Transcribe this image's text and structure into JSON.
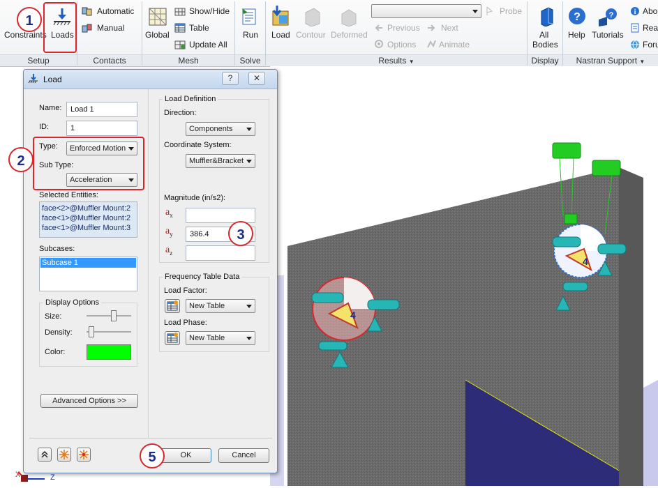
{
  "ribbon": {
    "setup": {
      "constraints": "Constraints",
      "loads": "Loads",
      "label": "Setup"
    },
    "contacts": {
      "automatic": "Automatic",
      "manual": "Manual",
      "label": "Contacts"
    },
    "mesh": {
      "global": "Global",
      "show_hide": "Show/Hide",
      "table": "Table",
      "update_all": "Update  All",
      "label": "Mesh"
    },
    "solve": {
      "run": "Run",
      "label": "Solve"
    },
    "results": {
      "load": "Load",
      "contour": "Contour",
      "deformed": "Deformed",
      "previous": "Previous",
      "next": "Next",
      "options": "Options",
      "animate": "Animate",
      "probe": "Probe",
      "label": "Results"
    },
    "display": {
      "all_bodies": "All Bodies",
      "all_bodies_l1": "All",
      "all_bodies_l2": "Bodies",
      "label": "Display"
    },
    "nastran": {
      "help": "Help",
      "tutorials": "Tutorials",
      "about": "Abo",
      "read": "Rea",
      "forum": "Foru",
      "label": "Nastran Support"
    }
  },
  "dialog": {
    "title": "Load",
    "help_btn": "?",
    "close_btn": "✕",
    "name_label": "Name:",
    "name_value": "Load 1",
    "id_label": "ID:",
    "id_value": "1",
    "type_label": "Type:",
    "type_value": "Enforced Motion",
    "subtype_label": "Sub Type:",
    "subtype_value": "Acceleration",
    "selected_label": "Selected Entities:",
    "entities": [
      "face<2>@Muffler Mount:2",
      "face<1>@Muffler Mount:2",
      "face<1>@Muffler Mount:3"
    ],
    "subcases_label": "Subcases:",
    "subcases": [
      "Subcase 1"
    ],
    "display_options": "Display Options",
    "size_label": "Size:",
    "density_label": "Density:",
    "color_label": "Color:",
    "color_value": "#00ff00",
    "size_level": 0.6,
    "density_level": 0.05,
    "advanced_btn": "Advanced Options >>",
    "load_definition": "Load Definition",
    "direction_label": "Direction:",
    "direction_value": "Components",
    "coord_label": "Coordinate System:",
    "coord_value": "Muffler&Bracket",
    "magnitude_label": "Magnitude (in/s2):",
    "ax_label": "a",
    "ax_sub": "x",
    "ax_value": "",
    "ay_label": "a",
    "ay_sub": "y",
    "ay_value": "386.4",
    "az_label": "a",
    "az_sub": "z",
    "az_value": "",
    "freq_label": "Frequency Table Data",
    "load_factor_label": "Load Factor:",
    "load_factor_value": "New Table",
    "load_phase_label": "Load Phase:",
    "load_phase_value": "New Table",
    "ok": "OK",
    "cancel": "Cancel"
  },
  "callouts": {
    "c1": "1",
    "c2": "2",
    "c3": "3",
    "c4": "4",
    "c5": "5"
  },
  "viewport": {
    "marker_a": "4",
    "marker_b": "4",
    "triad_x": "X",
    "triad_z": "Z"
  }
}
